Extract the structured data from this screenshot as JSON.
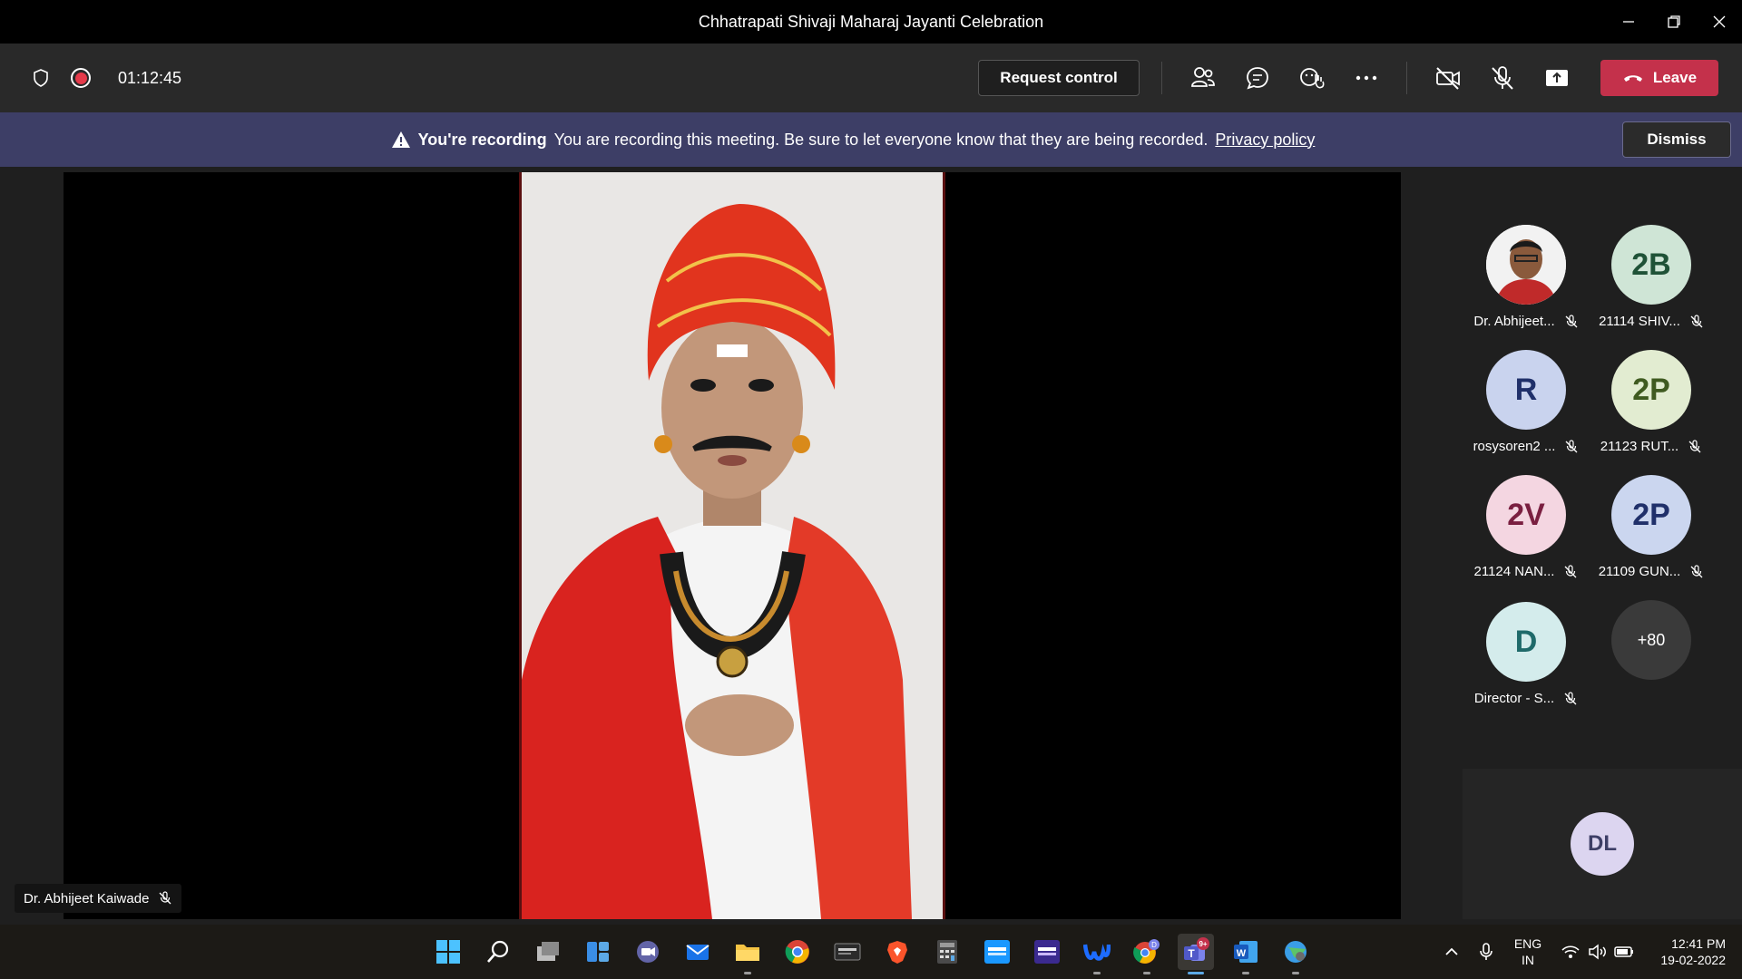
{
  "window": {
    "title": "Chhatrapati Shivaji Maharaj Jayanti Celebration"
  },
  "toolbar": {
    "timer": "01:12:45",
    "request_control": "Request control",
    "leave": "Leave",
    "leave_color": "#c4314b"
  },
  "banner": {
    "heading": "You're recording",
    "message": "You are recording this meeting. Be sure to let everyone know that they are being recorded.",
    "link": "Privacy policy",
    "dismiss": "Dismiss"
  },
  "stage": {
    "speaker_name": "Dr. Abhijeet Kaiwade"
  },
  "participants": [
    {
      "initials": "",
      "name": "Dr. Abhijeet...",
      "photo": true,
      "bg": "#ffffff",
      "fg": "#333333"
    },
    {
      "initials": "2B",
      "name": "21114 SHIV...",
      "bg": "#cfe5d6",
      "fg": "#1f5237"
    },
    {
      "initials": "R",
      "name": "rosysoren2 ...",
      "bg": "#c9d3ee",
      "fg": "#20306a"
    },
    {
      "initials": "2P",
      "name": "21123 RUT...",
      "bg": "#e2ecd1",
      "fg": "#3f5a20"
    },
    {
      "initials": "2V",
      "name": "21124 NAN...",
      "bg": "#f4d6e1",
      "fg": "#7a1f40"
    },
    {
      "initials": "2P",
      "name": "21109 GUN...",
      "bg": "#cbd6ef",
      "fg": "#20306a"
    },
    {
      "initials": "D",
      "name": "Director - S...",
      "bg": "#d4ecec",
      "fg": "#1f6a6a"
    },
    {
      "initials": "+80",
      "name": "",
      "more": true
    }
  ],
  "self_view": {
    "initials": "DL"
  },
  "taskbar": {
    "apps": [
      "start-icon",
      "search-icon",
      "task-view-icon",
      "widgets-icon",
      "chat-icon",
      "mail-icon",
      "file-explorer-icon",
      "chrome-icon",
      "msedge-app-icon",
      "brave-icon",
      "calculator-icon",
      "prime-video-icon",
      "amazon-music-icon",
      "webex-icon",
      "chrome-profile-icon",
      "teams-icon",
      "word-icon",
      "network-globe-icon"
    ],
    "teams_badge": "9+",
    "chrome_badge": "D",
    "language": "ENG",
    "region": "IN",
    "time": "12:41 PM",
    "date": "19-02-2022"
  }
}
